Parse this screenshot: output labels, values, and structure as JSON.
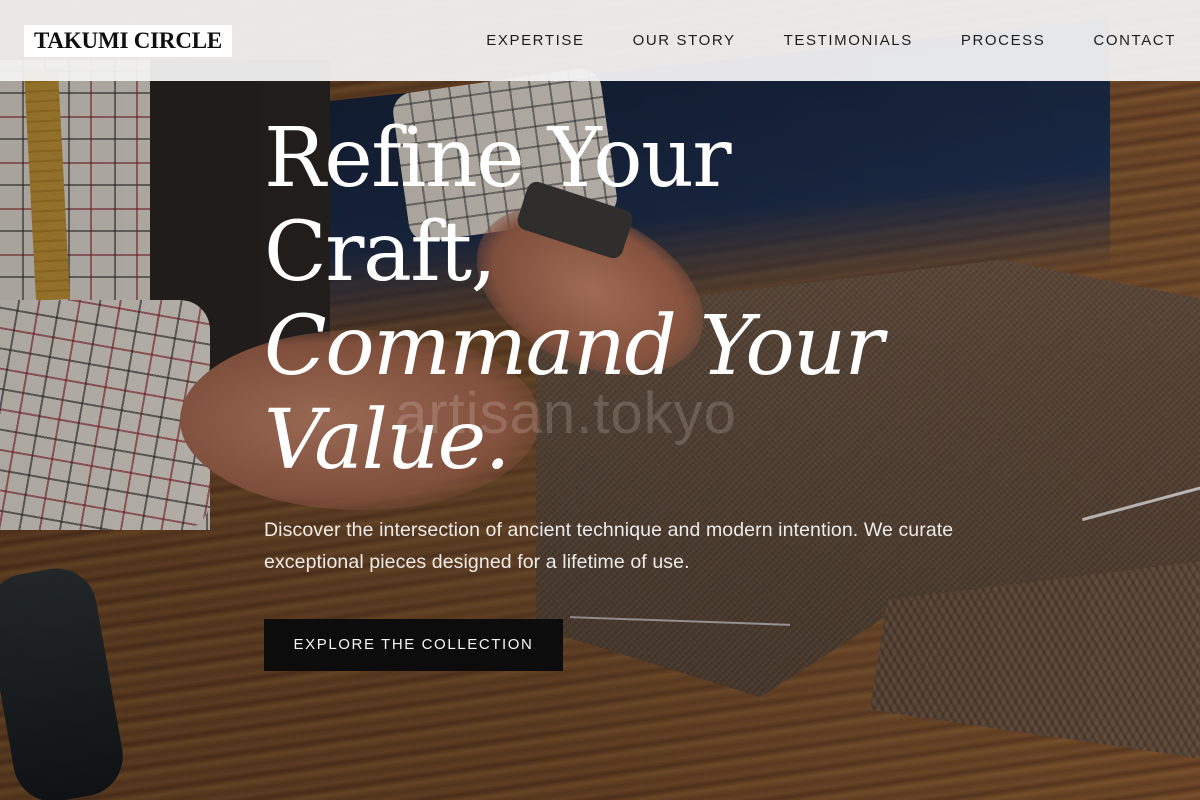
{
  "brand": {
    "name": "TAKUMI CIRCLE"
  },
  "nav": {
    "items": [
      {
        "label": "EXPERTISE"
      },
      {
        "label": "OUR STORY"
      },
      {
        "label": "TESTIMONIALS"
      },
      {
        "label": "PROCESS"
      },
      {
        "label": "CONTACT"
      }
    ]
  },
  "hero": {
    "headline": {
      "line1": "Refine Your",
      "line2": "Craft,",
      "line3": "Command Your",
      "line4": "Value."
    },
    "subtitle": "Discover the intersection of ancient technique and modern intention. We curate exceptional pieces designed for a lifetime of use.",
    "cta_label": "EXPLORE THE COLLECTION",
    "watermark": "artisan.tokyo"
  },
  "colors": {
    "header_bg": "#f3f3f3",
    "cta_bg": "#0c0c0c",
    "headline_text": "#ffffff"
  }
}
